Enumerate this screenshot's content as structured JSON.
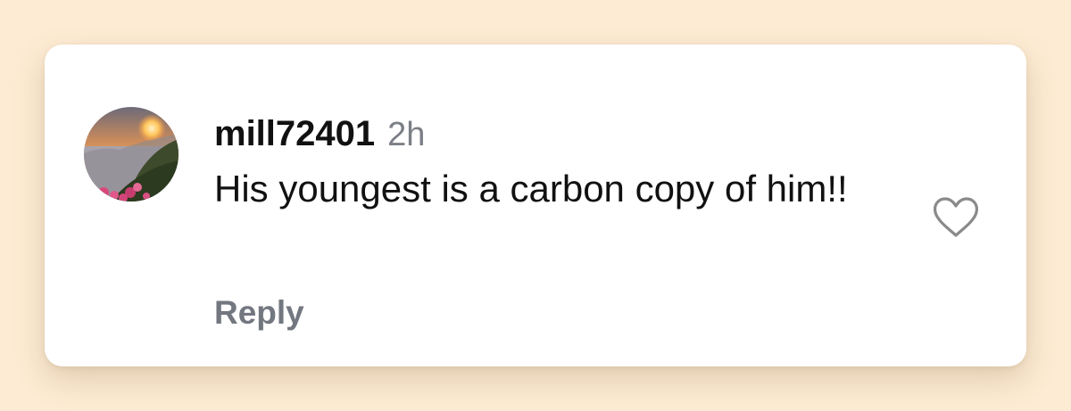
{
  "comment": {
    "username": "mill72401",
    "timestamp": "2h",
    "text": "His youngest is a carbon copy of him!!",
    "reply_label": "Reply",
    "like_icon": "heart-outline-icon",
    "avatar": "sunset-landscape-avatar"
  },
  "colors": {
    "page_background": "#fdebd3",
    "card_background": "#ffffff",
    "text_primary": "#111111",
    "text_secondary": "#737780",
    "icon": "#8a8a8a"
  }
}
